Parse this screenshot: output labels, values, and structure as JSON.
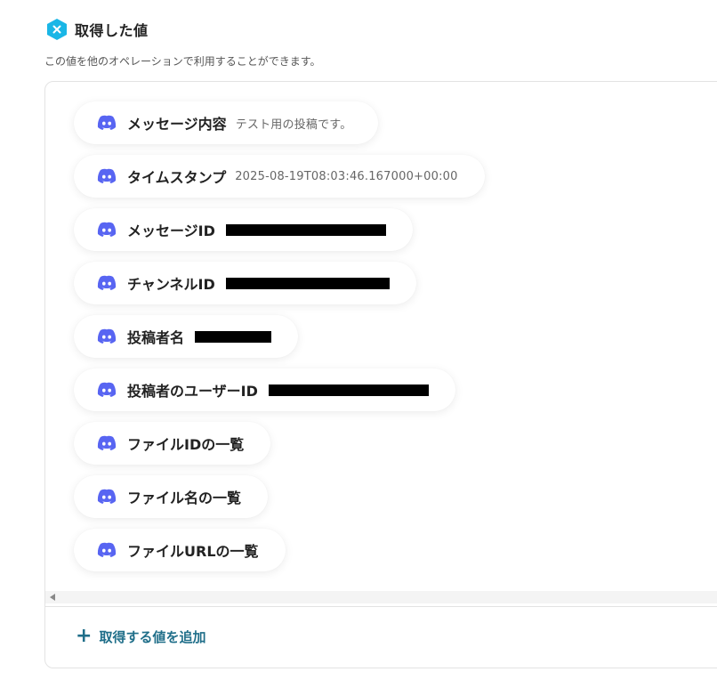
{
  "section": {
    "title": "取得した値",
    "description": "この値を他のオペレーションで利用することができます。"
  },
  "colors": {
    "accent": "#1f6e89",
    "header_icon": "#1ab6e6",
    "discord": "#5865f2"
  },
  "icons": {
    "header": "hexagon-x-icon",
    "item": "discord-icon",
    "add": "plus-icon"
  },
  "items": [
    {
      "label": "メッセージ内容",
      "value": "テスト用の投稿です。"
    },
    {
      "label": "タイムスタンプ",
      "value": "2025-08-19T08:03:46.167000+00:00"
    },
    {
      "label": "メッセージID",
      "redacted": true
    },
    {
      "label": "チャンネルID",
      "redacted": true
    },
    {
      "label": "投稿者名",
      "redacted": true
    },
    {
      "label": "投稿者のユーザーID",
      "redacted": true
    },
    {
      "label": "ファイルIDの一覧"
    },
    {
      "label": "ファイル名の一覧"
    },
    {
      "label": "ファイルURLの一覧"
    }
  ],
  "add_button": {
    "label": "取得する値を追加"
  }
}
